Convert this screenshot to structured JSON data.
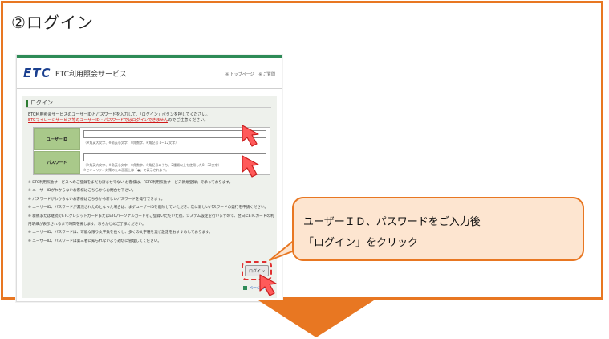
{
  "step": {
    "title": "②ログイン"
  },
  "screenshot": {
    "logo": "ETC",
    "service_name": "ETC利用照会サービス",
    "header_links": [
      "※ トップページ",
      "※ ご質問"
    ],
    "section_title": "ログイン",
    "intro_line1": "ETC利用照会サービスのユーザーIDとパスワードを入力して、「ログイン」ボタンを押してください。",
    "intro_warning": "ETCマイレージサービス等のユーザーID・パスワードではログインできません",
    "intro_line2_suffix": "のでご注意ください。",
    "form": {
      "user_id_label": "ユーザーID",
      "user_id_hint": "（※角英大文字、※角英小文字、※角数字、※角記号 4〜12文字）",
      "password_label": "パスワード",
      "password_hint": "（※角英大文字、※角英小文字、※角数字、※角記号のうち、2種類以上を使用した8〜32文字）",
      "password_hint2": "※セキュリティ対策のため画面上は「●」で表示されます。"
    },
    "notes": [
      "※ ETC利用照会サービスへのご登録をまだお済ませでない お客様は、「ETC利用照会サービス新規登録」で承っております。",
      "※ ユーザーIDがわからないお客様はこちらからお問合せ下さい。",
      "※ パスワードがわからないお客様はこちらから新しいパスワードを発行できます。",
      "※ ユーザーID、パスワードが漏洩されたのとなった場合は、まずユーザーIDを削除していただき、次に新しいパスワードの発行を申請ください。",
      "※ 新規または継続でETCクレジットカードまたはETCパーソナルカードをご登録いただいた後、システム設定を行いますので、翌日にETCカードの利用明細が表示されるまで時間を要します。あらかじめご了承ください。",
      "※ ユーザーID、パスワードは、可能な限り文字数を長くし、多くの文字種を混ぜ設定をおすすめしております。",
      "※ ユーザーID、パスワードは第三者に知られないよう適切に管理してください。"
    ],
    "login_button": "ログイン",
    "page_top": "ページの上へ"
  },
  "callout": {
    "line1": "ユーザーＩＤ、パスワードをご入力後",
    "line2": "「ログイン」をクリック"
  },
  "colors": {
    "accent": "#e87722",
    "callout_fill": "#fde5d0",
    "highlight_red": "#e03030",
    "brand_green": "#2e8b57"
  }
}
